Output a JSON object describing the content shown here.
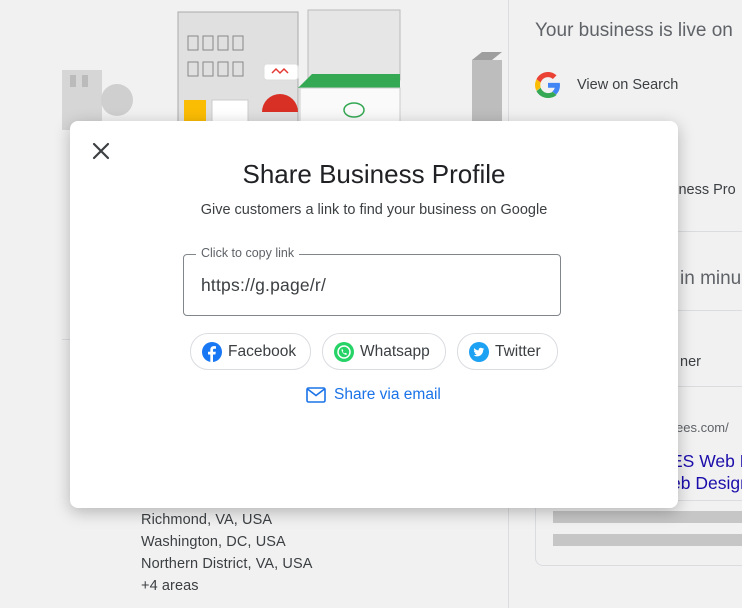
{
  "background": {
    "service_areas": [
      "Richmond, VA, USA",
      "Washington, DC, USA",
      "Northern District, VA, USA",
      "+4 areas"
    ],
    "right_panel": {
      "live_title": "Your business is live on",
      "view_on_search": "View on Search",
      "fragment_profile": "siness Pro",
      "fragment_minutes": "in minu",
      "fragment_owner": "ner",
      "fragment_url": "ees.com/",
      "fragment_web1": "ES Web D",
      "fragment_web2": "eb Design"
    }
  },
  "dialog": {
    "title": "Share Business Profile",
    "subtitle": "Give customers a link to find your business on Google",
    "link_field": {
      "label": "Click to copy link",
      "value": "https://g.page/r/"
    },
    "share_buttons": [
      {
        "label": "Facebook",
        "icon": "facebook-icon",
        "color": "#1877f2"
      },
      {
        "label": "Whatsapp",
        "icon": "whatsapp-icon",
        "color": "#25d366"
      },
      {
        "label": "Twitter",
        "icon": "twitter-icon",
        "color": "#1da1f2"
      }
    ],
    "email_label": "Share via email",
    "close_icon": "close-icon"
  },
  "colors": {
    "accent": "#1a73e8",
    "text_primary": "#202124",
    "text_secondary": "#3c4043"
  }
}
